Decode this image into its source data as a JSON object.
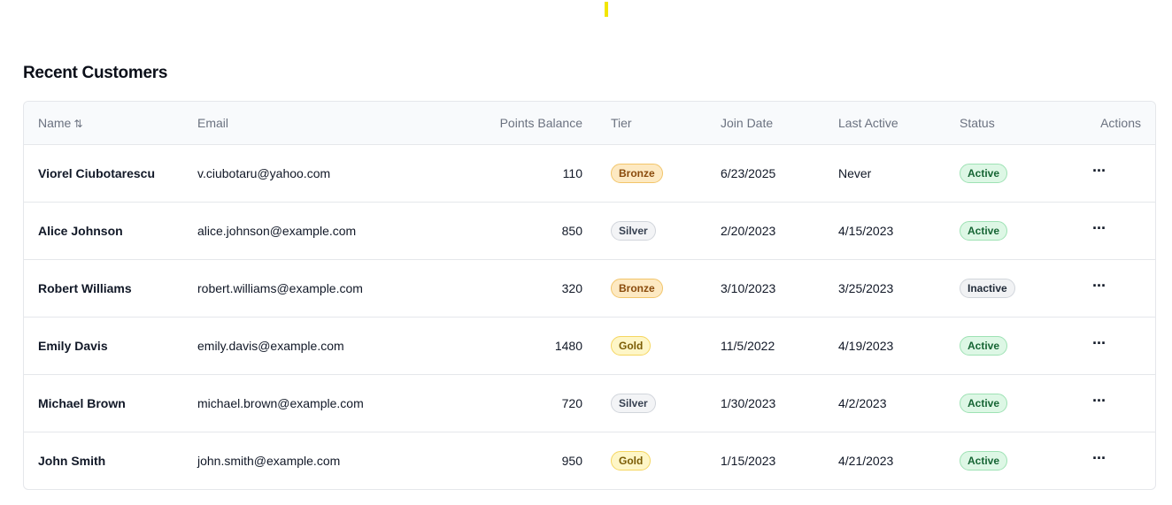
{
  "page": {
    "title": "Recent Customers"
  },
  "table": {
    "columns": {
      "name": "Name",
      "sort_icon": "⇅",
      "email": "Email",
      "points": "Points Balance",
      "tier": "Tier",
      "join_date": "Join Date",
      "last_active": "Last Active",
      "status": "Status",
      "actions": "Actions"
    },
    "rows": [
      {
        "name": "Viorel Ciubotarescu",
        "email": "v.ciubotaru@yahoo.com",
        "points": "110",
        "tier": "Bronze",
        "join_date": "6/23/2025",
        "last_active": "Never",
        "status": "Active",
        "action_icon": "···"
      },
      {
        "name": "Alice Johnson",
        "email": "alice.johnson@example.com",
        "points": "850",
        "tier": "Silver",
        "join_date": "2/20/2023",
        "last_active": "4/15/2023",
        "status": "Active",
        "action_icon": "···"
      },
      {
        "name": "Robert Williams",
        "email": "robert.williams@example.com",
        "points": "320",
        "tier": "Bronze",
        "join_date": "3/10/2023",
        "last_active": "3/25/2023",
        "status": "Inactive",
        "action_icon": "···"
      },
      {
        "name": "Emily Davis",
        "email": "emily.davis@example.com",
        "points": "1480",
        "tier": "Gold",
        "join_date": "11/5/2022",
        "last_active": "4/19/2023",
        "status": "Active",
        "action_icon": "···"
      },
      {
        "name": "Michael Brown",
        "email": "michael.brown@example.com",
        "points": "720",
        "tier": "Silver",
        "join_date": "1/30/2023",
        "last_active": "4/2/2023",
        "status": "Active",
        "action_icon": "···"
      },
      {
        "name": "John Smith",
        "email": "john.smith@example.com",
        "points": "950",
        "tier": "Gold",
        "join_date": "1/15/2023",
        "last_active": "4/21/2023",
        "status": "Active",
        "action_icon": "···"
      }
    ]
  },
  "colors": {
    "tier": {
      "Bronze": {
        "bg": "#fde9c2",
        "border": "#f2c56a",
        "text": "#8a4b0c"
      },
      "Silver": {
        "bg": "#f3f4f6",
        "border": "#d1d5db",
        "text": "#374151"
      },
      "Gold": {
        "bg": "#fef6c7",
        "border": "#f5d660",
        "text": "#7a5c04"
      }
    },
    "status": {
      "Active": {
        "bg": "#ddf7e5",
        "border": "#9ee2b4",
        "text": "#166534"
      },
      "Inactive": {
        "bg": "#f1f2f4",
        "border": "#d1d5db",
        "text": "#1f2937"
      }
    },
    "top_marker": "#f2e600"
  }
}
